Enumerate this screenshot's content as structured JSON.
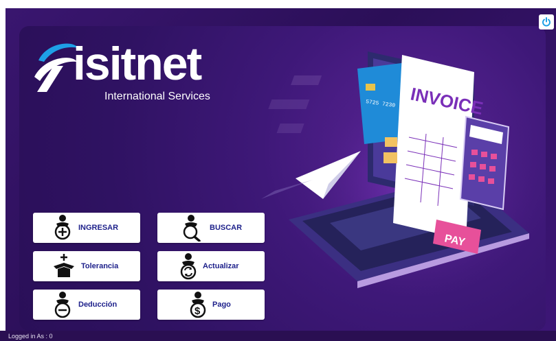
{
  "brand": {
    "name": "isitnet",
    "tagline": "International Services"
  },
  "menu": [
    {
      "label": "INGRESAR",
      "icon": "user-add-icon"
    },
    {
      "label": "BUSCAR",
      "icon": "user-search-icon"
    },
    {
      "label": "Tolerancia",
      "icon": "box-plus-icon"
    },
    {
      "label": "Actualizar",
      "icon": "user-refresh-icon"
    },
    {
      "label": "Deducción",
      "icon": "user-minus-icon"
    },
    {
      "label": "Pago",
      "icon": "user-dollar-icon"
    }
  ],
  "illustration": {
    "invoice_title": "INVOICE",
    "pay_label": "PAY",
    "card_number": "5725 7230"
  },
  "status": {
    "logged_in": "Logged in As : 0"
  },
  "colors": {
    "background": "#2a0f58",
    "button_text": "#1c1f8a",
    "accent_pink": "#e7509a",
    "logo_blue": "#1ea0e6"
  }
}
